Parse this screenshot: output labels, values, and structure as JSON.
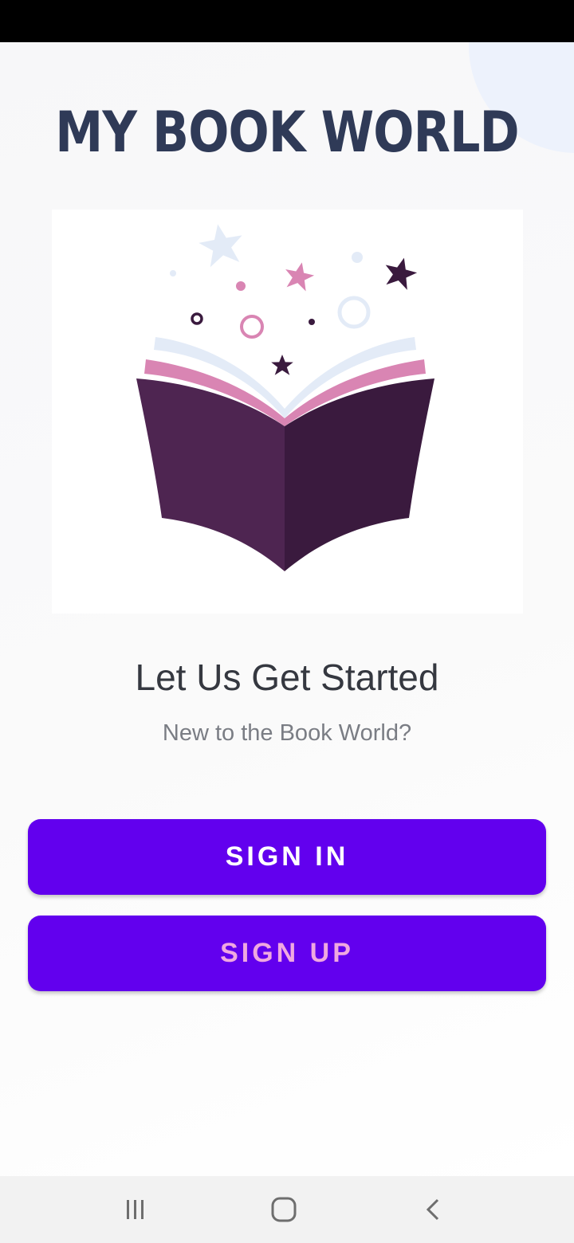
{
  "app": {
    "title": "MY BOOK WORLD"
  },
  "welcome": {
    "headline": "Let Us Get Started",
    "subtext": "New to the Book World?"
  },
  "actions": {
    "sign_in_label": "SIGN IN",
    "sign_up_label": "SIGN UP"
  },
  "colors": {
    "accent": "#6200ee",
    "title": "#2f3a57",
    "book_dark": "#3a1a3e",
    "book_light": "#4e2551",
    "pink": "#d985b3",
    "light_blue": "#e3ebf7"
  },
  "icons": {
    "hero": "open-book-with-stars-illustration",
    "nav_recents": "recent-apps-icon",
    "nav_home": "home-icon",
    "nav_back": "back-icon"
  }
}
